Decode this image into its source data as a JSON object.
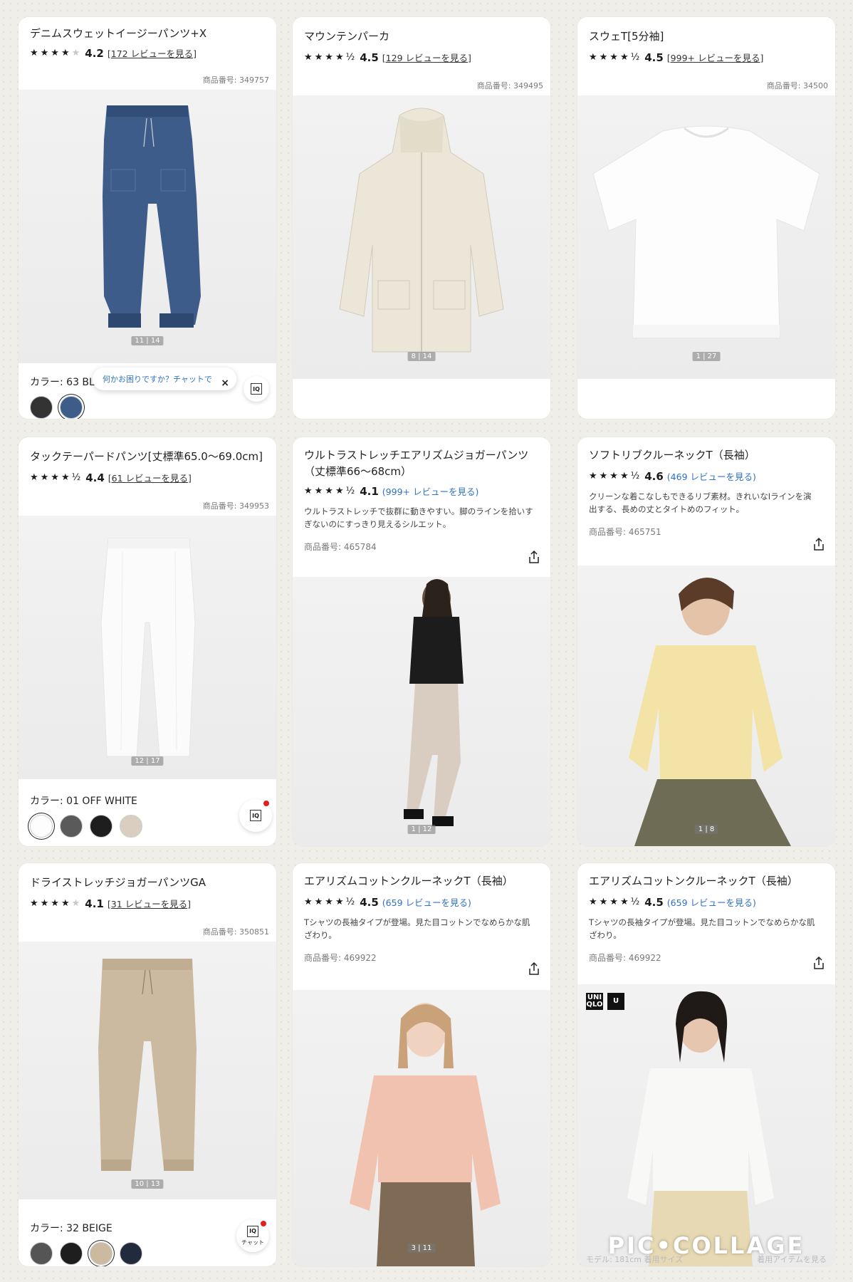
{
  "colors": {
    "accent": "#2d72c4",
    "badge": "#e02020"
  },
  "cards": [
    {
      "title": "デニムスウェットイージーパンツ+X",
      "score": "4.2",
      "reviews": "[172 レビューを見る]",
      "product_id": "商品番号: 349757",
      "image_counter": "11 | 14",
      "color_label": "カラー:  63 BLUE",
      "chat_bubble": "何かお困りですか？チャットで",
      "close": "×"
    },
    {
      "title": "マウンテンパーカ",
      "score": "4.5",
      "reviews": "[129 レビューを見る]",
      "product_id": "商品番号: 349495",
      "image_counter": "8 | 14"
    },
    {
      "title": "スウェT[5分袖]",
      "score": "4.5",
      "reviews": "[999+ レビューを見る]",
      "product_id": "商品番号: 34500",
      "image_counter": "1 | 27"
    },
    {
      "title": "タックテーパードパンツ[丈標準65.0〜69.0cm]",
      "score": "4.4",
      "reviews": "[61 レビューを見る]",
      "product_id": "商品番号: 349953",
      "image_counter": "12 | 17",
      "color_label": "カラー:  01 OFF WHITE"
    },
    {
      "title": "ウルトラストレッチエアリズムジョガーパンツ（丈標準66〜68cm）",
      "score": "4.1",
      "reviews": "(999+ レビューを見る)",
      "description": "ウルトラストレッチで抜群に動きやすい。脚のラインを拾いすぎないのにすっきり見えるシルエット。",
      "product_id": "商品番号: 465784",
      "image_counter": "1 | 12"
    },
    {
      "title": "ソフトリブクルーネックT（長袖）",
      "score": "4.6",
      "reviews": "(469 レビューを見る)",
      "description": "クリーンな着こなしもできるリブ素材。きれいなIラインを演出する、長めの丈とタイトめのフィット。",
      "product_id": "商品番号: 465751",
      "image_counter": "1 | 8"
    },
    {
      "title": "ドライストレッチジョガーパンツGA",
      "score": "4.1",
      "reviews": "[31 レビューを見る]",
      "product_id": "商品番号: 350851",
      "image_counter": "10 | 13",
      "color_label": "カラー:  32 BEIGE",
      "chat_label": "チャット"
    },
    {
      "title": "エアリズムコットンクルーネックT（長袖）",
      "score": "4.5",
      "reviews": "(659 レビューを見る)",
      "description": "Tシャツの長袖タイプが登場。見た目コットンでなめらかな肌ざわり。",
      "product_id": "商品番号: 469922",
      "image_counter": "3 | 11"
    },
    {
      "title": "エアリズムコットンクルーネックT（長袖）",
      "score": "4.5",
      "reviews": "(659 レビューを見る)",
      "description": "Tシャツの長袖タイプが登場。見た目コットンでなめらかな肌ざわり。",
      "product_id": "商品番号: 469922",
      "logo": [
        "UNI QLO",
        "U"
      ],
      "caption_left": "モデル: 181cm 着用サイズ",
      "caption_right": "着用アイテムを見る"
    }
  ],
  "watermark": "PIC•COLLAGE"
}
